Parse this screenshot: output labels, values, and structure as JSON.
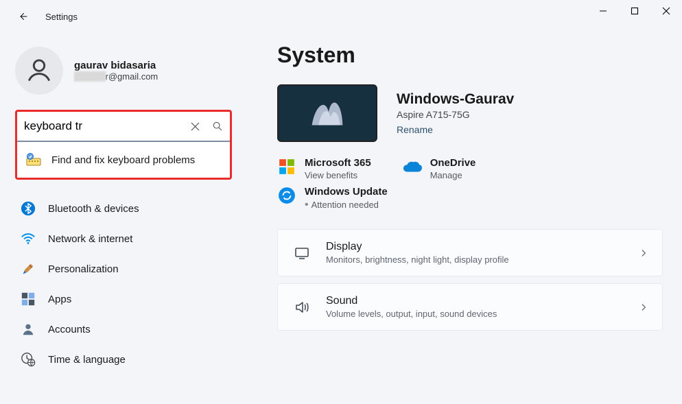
{
  "app_name": "Settings",
  "user": {
    "name": "gaurav bidasaria",
    "email": "r@gmail.com"
  },
  "search": {
    "value": "keyboard tr",
    "suggestion": "Find and fix keyboard problems"
  },
  "nav_items": [
    {
      "label": "Bluetooth & devices"
    },
    {
      "label": "Network & internet"
    },
    {
      "label": "Personalization"
    },
    {
      "label": "Apps"
    },
    {
      "label": "Accounts"
    },
    {
      "label": "Time & language"
    }
  ],
  "page_title": "System",
  "pc": {
    "name": "Windows-Gaurav",
    "model": "Aspire A715-75G",
    "rename": "Rename"
  },
  "status": {
    "m365": {
      "title": "Microsoft 365",
      "sub": "View benefits"
    },
    "onedrive": {
      "title": "OneDrive",
      "sub": "Manage"
    },
    "update": {
      "title": "Windows Update",
      "sub": "Attention needed"
    }
  },
  "cards": [
    {
      "title": "Display",
      "sub": "Monitors, brightness, night light, display profile"
    },
    {
      "title": "Sound",
      "sub": "Volume levels, output, input, sound devices"
    }
  ]
}
